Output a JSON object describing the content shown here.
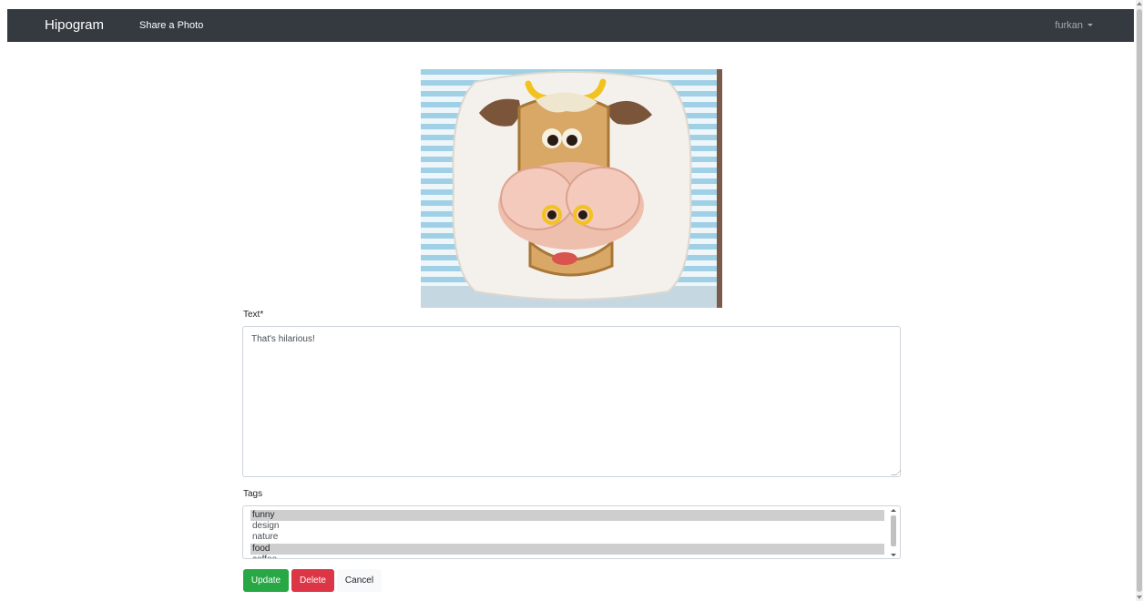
{
  "navbar": {
    "brand": "Hipogram",
    "share_link": "Share a Photo",
    "user": "furkan"
  },
  "photo": {
    "icon": "cow-sandwich-photo"
  },
  "form": {
    "text_label": "Text*",
    "text_value": "That's hilarious!",
    "tags_label": "Tags",
    "tags": [
      {
        "label": "funny",
        "selected": true
      },
      {
        "label": "design",
        "selected": false
      },
      {
        "label": "nature",
        "selected": false
      },
      {
        "label": "food",
        "selected": true
      },
      {
        "label": "coffee",
        "selected": false
      }
    ],
    "update_label": "Update",
    "delete_label": "Delete",
    "cancel_label": "Cancel"
  },
  "colors": {
    "navbar_bg": "#343a40",
    "update": "#28a745",
    "delete": "#dc3545",
    "selected_option": "#cecece"
  }
}
